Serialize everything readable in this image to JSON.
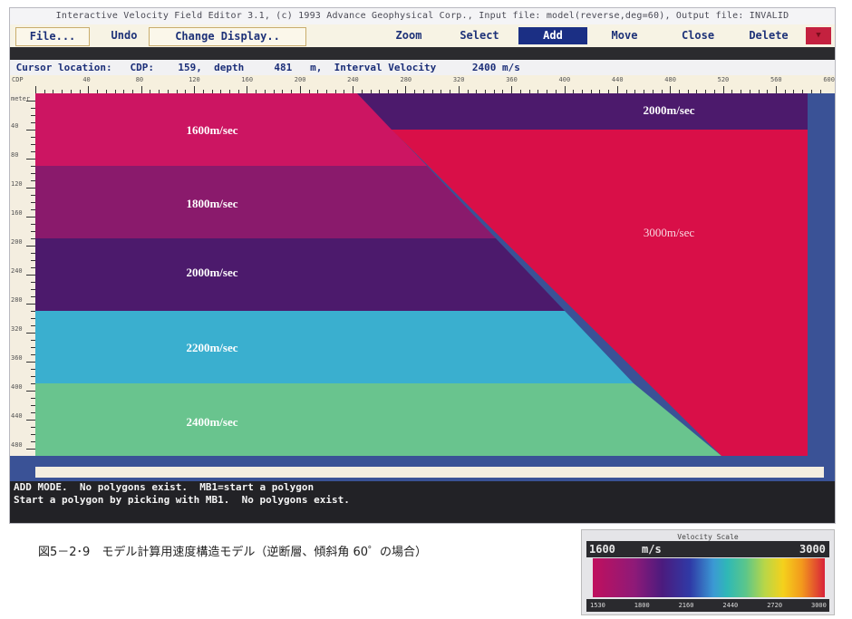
{
  "window": {
    "title": "Interactive Velocity Field Editor 3.1,  (c) 1993 Advance Geophysical Corp.,   Input file: model(reverse,deg=60),   Output file: INVALID"
  },
  "menu": {
    "file": "File...",
    "undo": "Undo",
    "change_display": "Change Display..",
    "zoom": "Zoom",
    "select": "Select",
    "add": "Add",
    "move": "Move",
    "close": "Close",
    "delete": "Delete",
    "indicator": "▼"
  },
  "status": {
    "text": " Cursor location:   CDP:    159,  depth     481   m,  Interval Velocity      2400 m/s"
  },
  "ruler": {
    "x_label": "CDP",
    "x_ticks": [
      "40",
      "80",
      "120",
      "160",
      "200",
      "240",
      "280",
      "320",
      "360",
      "400",
      "440",
      "480",
      "520",
      "560",
      "600"
    ],
    "y_label": "meter",
    "y_ticks": [
      "40",
      "80",
      "120",
      "160",
      "200",
      "240",
      "280",
      "320",
      "360",
      "400",
      "440",
      "480"
    ]
  },
  "layers": [
    {
      "label": "1600m/sec",
      "color": "#cc1562"
    },
    {
      "label": "1800m/sec",
      "color": "#8a1a6c"
    },
    {
      "label": "2000m/sec",
      "color": "#4c1a6c"
    },
    {
      "label": "2200m/sec",
      "color": "#3aafcf"
    },
    {
      "label": "2400m/sec",
      "color": "#69c48e"
    },
    {
      "label": "2000m/sec",
      "color": "#4c1a6c"
    },
    {
      "label": "3000m/sec",
      "color": "#d90f48"
    }
  ],
  "messages": [
    "ADD MODE.  No polygons exist.  MB1=start a polygon",
    "Start a polygon by picking with MB1.  No polygons exist."
  ],
  "caption": "図5－2･9　モデル計算用速度構造モデル（逆断層、傾斜角 60゜の場合）",
  "velocity_scale": {
    "title": "Velocity Scale",
    "low": "1600",
    "unit": "m/s",
    "high": "3000",
    "ticks": [
      "1530",
      "1800",
      "2160",
      "2440",
      "2720",
      "3000"
    ]
  }
}
